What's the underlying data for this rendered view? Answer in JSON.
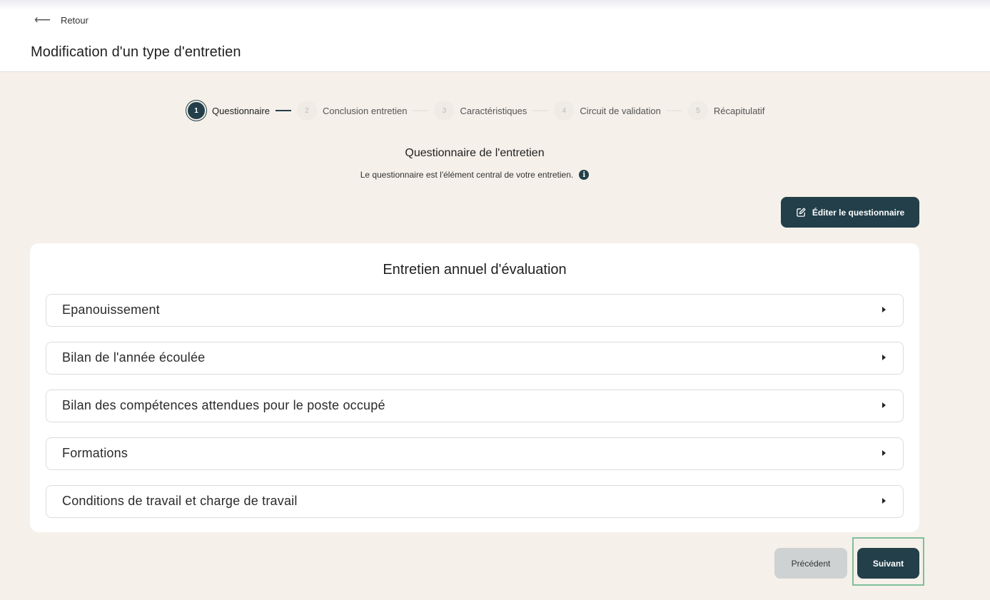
{
  "header": {
    "back_label": "Retour",
    "back_icon": "arrow-left-icon",
    "title": "Modification d'un type d'entretien"
  },
  "stepper": {
    "steps": [
      {
        "number": "1",
        "label": "Questionnaire",
        "active": true
      },
      {
        "number": "2",
        "label": "Conclusion entretien",
        "active": false
      },
      {
        "number": "3",
        "label": "Caractéristiques",
        "active": false
      },
      {
        "number": "4",
        "label": "Circuit de validation",
        "active": false
      },
      {
        "number": "5",
        "label": "Récapitulatif",
        "active": false
      }
    ]
  },
  "section": {
    "title": "Questionnaire de l'entretien",
    "subtitle": "Le questionnaire est l'élément central de votre entretien.",
    "info_icon": "i"
  },
  "actions": {
    "edit_label": "Éditer le questionnaire",
    "edit_icon": "edit-icon"
  },
  "card": {
    "title": "Entretien annuel d'évaluation",
    "sections": [
      {
        "label": "Epanouissement"
      },
      {
        "label": "Bilan de l'année écoulée"
      },
      {
        "label": "Bilan des compétences attendues pour le poste occupé"
      },
      {
        "label": "Formations"
      },
      {
        "label": "Conditions de travail et charge de travail"
      }
    ]
  },
  "footer": {
    "prev_label": "Précédent",
    "next_label": "Suivant"
  },
  "colors": {
    "primary": "#223f4a",
    "background": "#f5f0e9",
    "secondary_button": "#cfd2d3",
    "focus_outline": "#7fbf9a"
  }
}
